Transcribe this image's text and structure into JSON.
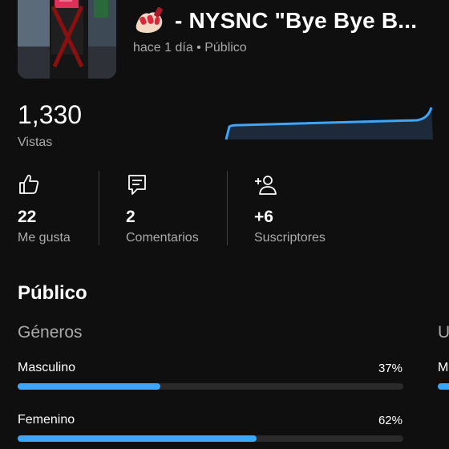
{
  "video": {
    "title": "- NYSNC \"Bye Bye B...",
    "meta": "hace 1 día • Público",
    "emoji_icon": "nail-polish-icon"
  },
  "views": {
    "count": "1,330",
    "label": "Vistas",
    "trend_color": "#3ea6ff"
  },
  "stats": [
    {
      "icon": "thumbs-up-icon",
      "value": "22",
      "label": "Me gusta"
    },
    {
      "icon": "comment-icon",
      "value": "2",
      "label": "Comentarios"
    },
    {
      "icon": "add-person-icon",
      "value": "+6",
      "label": "Suscriptores"
    }
  ],
  "audience": {
    "title": "Público",
    "genders": {
      "title": "Géneros",
      "rows": [
        {
          "label": "Masculino",
          "pct": "37%",
          "fraction": 0.37
        },
        {
          "label": "Femenino",
          "pct": "62%",
          "fraction": 0.62
        }
      ]
    },
    "next_section_partial": {
      "title": "U",
      "row_label": "M"
    }
  },
  "colors": {
    "accent": "#3ea6ff",
    "background": "#0f0f0f",
    "secondary_text": "#aaaaaa"
  }
}
